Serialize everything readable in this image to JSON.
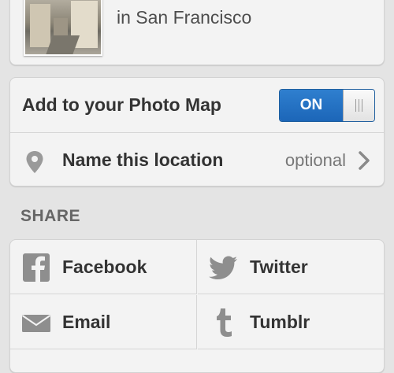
{
  "caption": {
    "text": "in San Francisco"
  },
  "photo_map": {
    "label": "Add to your Photo Map",
    "toggle_state": "ON",
    "toggle_color": "#1c66b8"
  },
  "location": {
    "label": "Name this location",
    "hint": "optional",
    "icon": "map-pin-icon"
  },
  "share": {
    "title": "SHARE",
    "items": [
      {
        "label": "Facebook",
        "icon": "facebook-icon"
      },
      {
        "label": "Twitter",
        "icon": "twitter-icon"
      },
      {
        "label": "Email",
        "icon": "email-icon"
      },
      {
        "label": "Tumblr",
        "icon": "tumblr-icon"
      }
    ]
  }
}
